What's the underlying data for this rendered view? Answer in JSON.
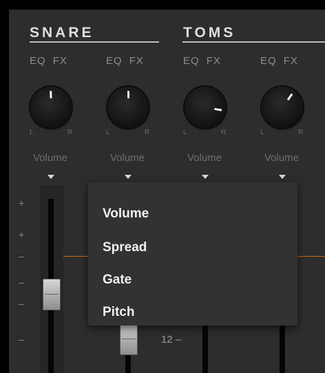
{
  "groups": [
    {
      "title": "SNARE"
    },
    {
      "title": "TOMS"
    }
  ],
  "channels": [
    {
      "eq": "EQ",
      "fx": "FX",
      "pan_left": "L",
      "pan_right": "R",
      "mode": "Volume"
    },
    {
      "eq": "EQ",
      "fx": "FX",
      "pan_left": "L",
      "pan_right": "R",
      "mode": "Volume"
    },
    {
      "eq": "EQ",
      "fx": "FX",
      "pan_left": "L",
      "pan_right": "R",
      "mode": "Volume"
    },
    {
      "eq": "EQ",
      "fx": "FX",
      "pan_left": "L",
      "pan_right": "R",
      "mode": "Volume"
    }
  ],
  "scale": {
    "marks": [
      "+",
      "+",
      "–",
      "–",
      "–",
      "–"
    ],
    "db_label": "12 –"
  },
  "dropdown": {
    "items": [
      "Volume",
      "Spread",
      "Gate",
      "Pitch"
    ],
    "selected": "Volume"
  },
  "colors": {
    "background": "#2d2d2d",
    "accent": "#c86a1a",
    "menu": "#333233"
  }
}
